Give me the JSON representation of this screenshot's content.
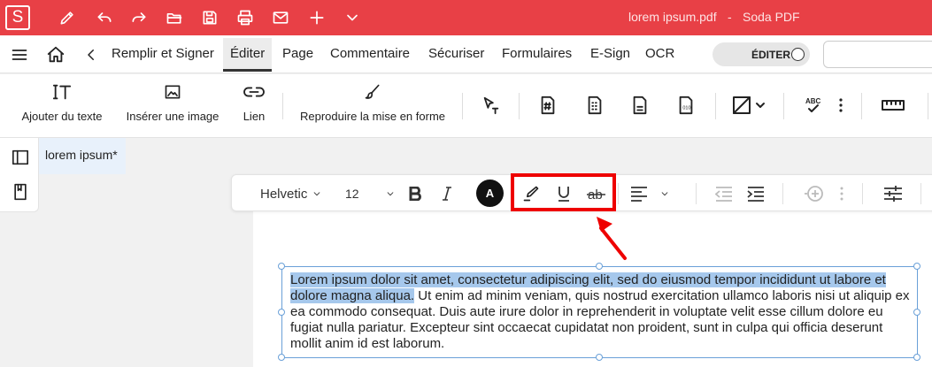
{
  "title_bar": {
    "logo_letter": "S",
    "filename": "lorem ipsum.pdf",
    "separator": "-",
    "app_name": "Soda PDF",
    "bg_color": "#e84046"
  },
  "menu": {
    "items": [
      {
        "label": "Remplir et Signer"
      },
      {
        "label": "Éditer"
      },
      {
        "label": "Page"
      },
      {
        "label": "Commentaire"
      },
      {
        "label": "Sécuriser"
      },
      {
        "label": "Formulaires"
      },
      {
        "label": "E-Sign"
      },
      {
        "label": "OCR"
      }
    ],
    "active": "Éditer",
    "edit_toggle_label": "ÉDITER"
  },
  "ribbon": {
    "add_text_label": "Ajouter du texte",
    "insert_image_label": "Insérer une image",
    "link_label": "Lien",
    "format_painter_label": "Reproduire la mise en forme"
  },
  "document": {
    "tab_label": "lorem ipsum",
    "tab_modified_mark": "*"
  },
  "format_bar": {
    "font": "Helvetic",
    "size": "12",
    "color_letter": "A",
    "text_color": "#111111"
  },
  "text": {
    "selected": "Lorem ipsum dolor sit amet, consectetur adipiscing elit, sed do eiusmod tempor incididunt ut labore et dolore magna aliqua.",
    "rest": " Ut enim ad minim veniam, quis nostrud exercitation ullamco laboris nisi ut aliquip ex ea commodo consequat. Duis aute irure dolor in reprehenderit in voluptate velit esse cillum dolore eu fugiat nulla pariatur. Excepteur sint occaecat cupidatat non proident, sunt in culpa qui officia deserunt mollit anim id est laborum."
  },
  "annotation": {
    "color": "#e00000"
  }
}
